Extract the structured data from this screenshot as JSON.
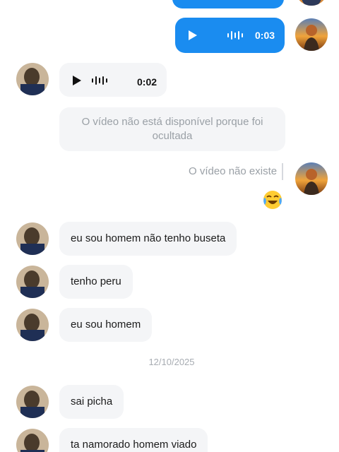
{
  "chat": {
    "voice_out": {
      "duration": "0:03"
    },
    "voice_in": {
      "duration": "0:02"
    },
    "video_notice": "O vídeo não está disponível porque foi ocultada",
    "video_missing": "O vídeo não existe",
    "reaction_emoji": "face-with-tears-of-joy",
    "messages": [
      {
        "text": "eu sou homem não tenho buseta"
      },
      {
        "text": "tenho peru"
      },
      {
        "text": "eu sou homem"
      },
      {
        "text": "sai picha"
      },
      {
        "text": "ta namorado homem viado"
      }
    ],
    "date_separator": "12/10/2025"
  },
  "colors": {
    "outgoing_bubble": "#1a8cf0",
    "incoming_bubble": "#f4f5f7",
    "muted_text": "#9aa0a6"
  }
}
